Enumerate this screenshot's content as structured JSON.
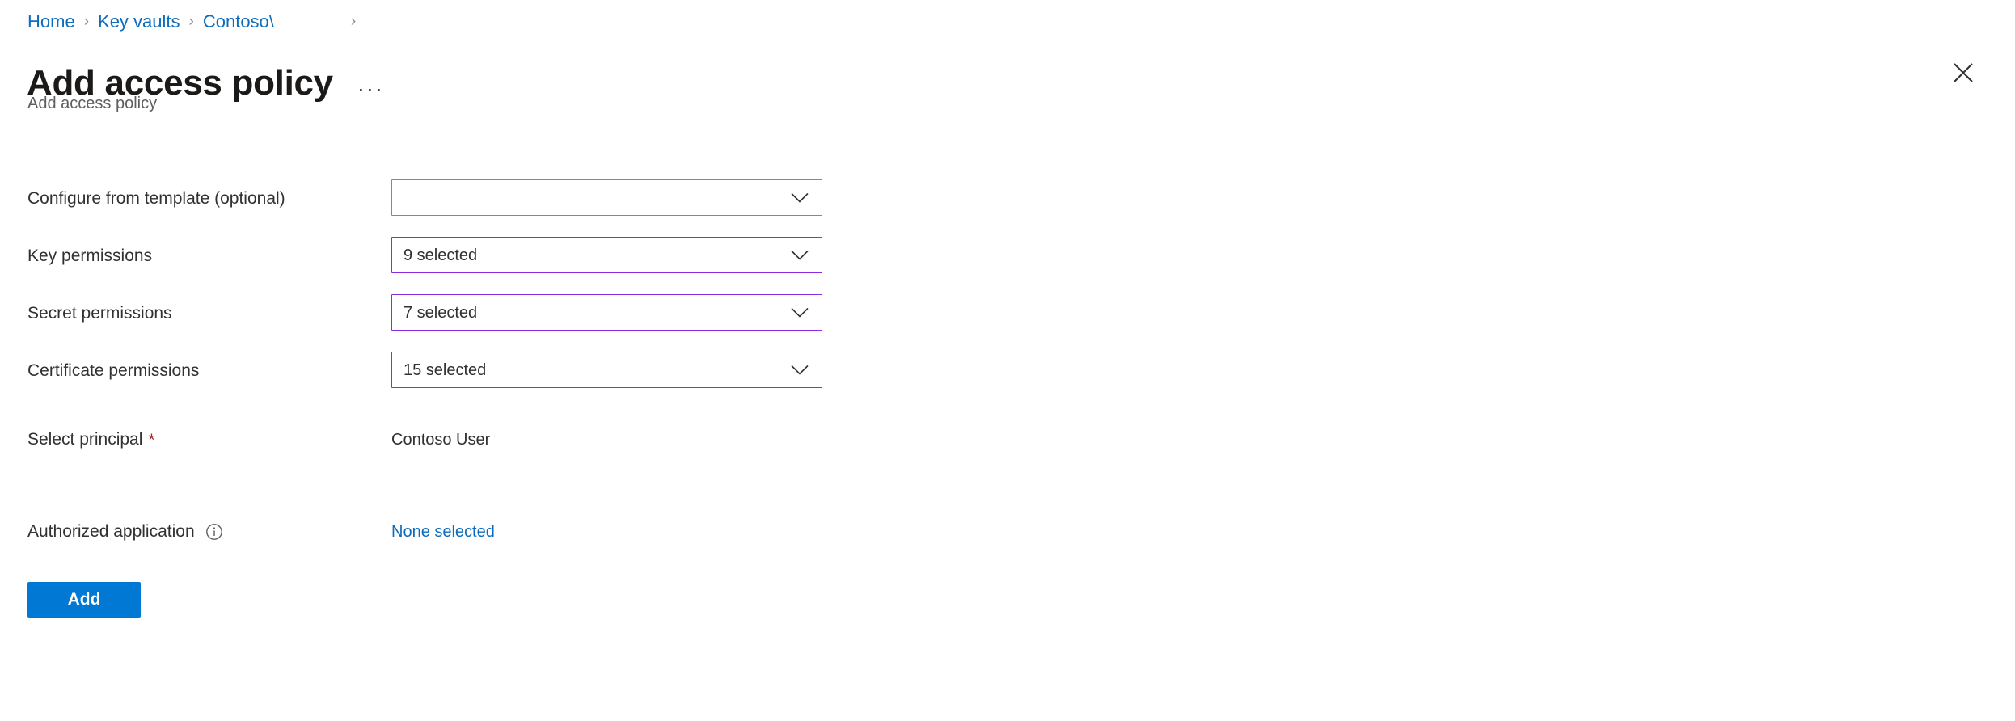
{
  "breadcrumb": {
    "items": [
      {
        "label": "Home",
        "truncated": false
      },
      {
        "label": "Key vaults",
        "truncated": false
      },
      {
        "label": "Contoso\\",
        "truncated": true
      }
    ],
    "separator": "›"
  },
  "header": {
    "title": "Add access policy",
    "subtitle": "Add access policy",
    "more_label": "···",
    "close_icon": "close-icon"
  },
  "form": {
    "template": {
      "label": "Configure from template (optional)",
      "value": "",
      "placeholder": "",
      "accent": false,
      "chevron_icon": "chevron-down-icon"
    },
    "key_permissions": {
      "label": "Key permissions",
      "value": "9 selected",
      "accent": true,
      "chevron_icon": "chevron-down-icon"
    },
    "secret_permissions": {
      "label": "Secret permissions",
      "value": "7 selected",
      "accent": true,
      "chevron_icon": "chevron-down-icon"
    },
    "certificate_permissions": {
      "label": "Certificate permissions",
      "value": "15 selected",
      "accent": true,
      "chevron_icon": "chevron-down-icon"
    },
    "select_principal": {
      "label": "Select principal",
      "required_marker": "*",
      "value": "Contoso User"
    },
    "authorized_application": {
      "label": "Authorized application",
      "info_icon": "info-icon",
      "value": "None selected"
    }
  },
  "actions": {
    "add_label": "Add"
  },
  "colors": {
    "link": "#0f6cbd",
    "primary_button": "#0078d4",
    "accent_border": "#8a2be2",
    "required": "#a4262c",
    "text": "#323130",
    "subtle_text": "#605e5c"
  }
}
